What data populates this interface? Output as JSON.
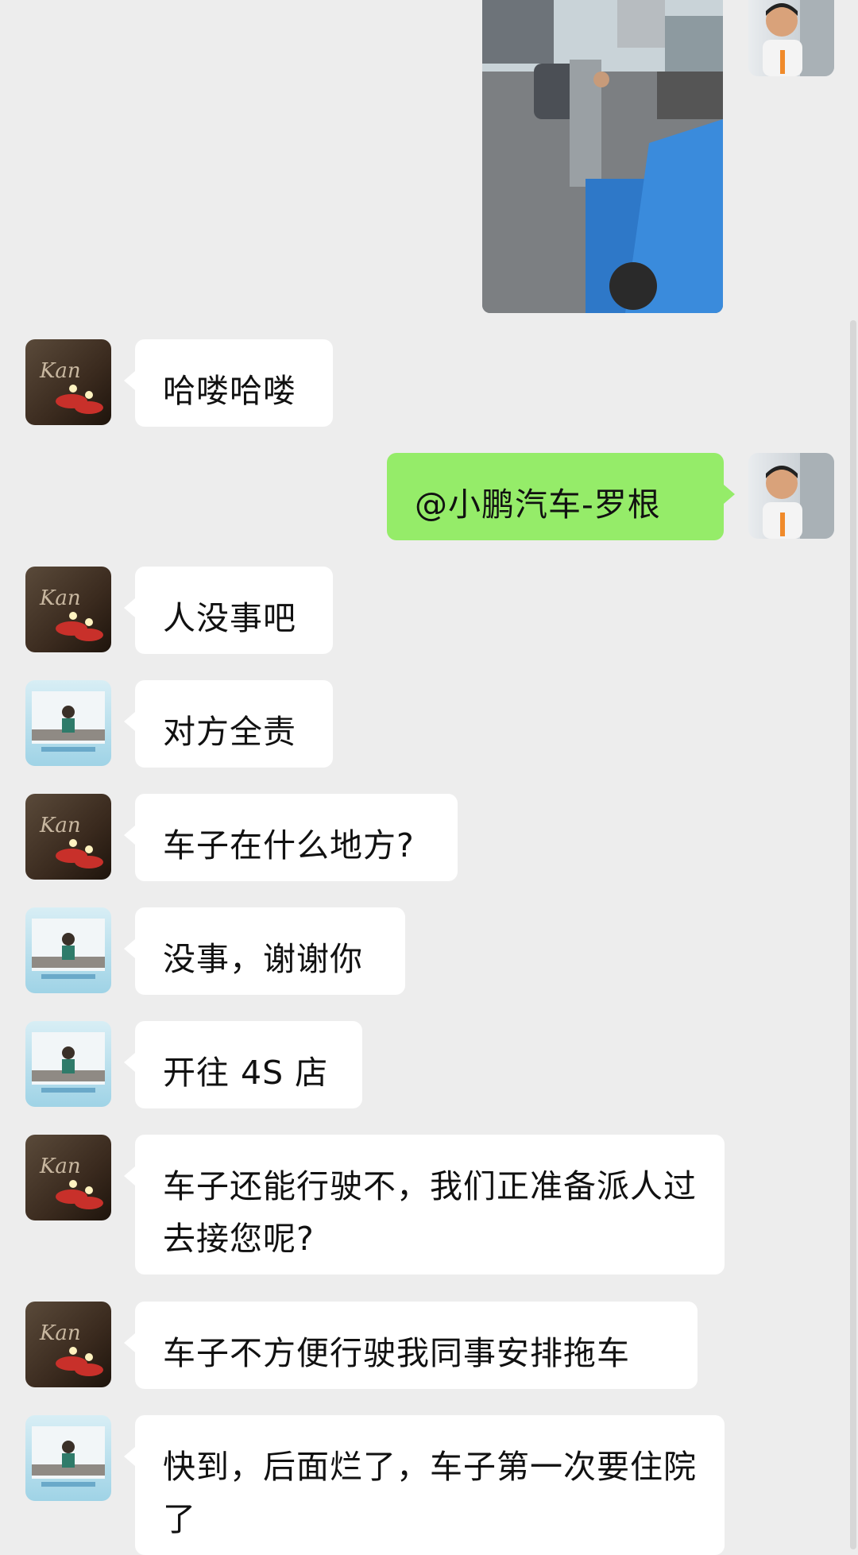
{
  "colors": {
    "background": "#ededed",
    "bubble_incoming": "#ffffff",
    "bubble_outgoing": "#95ec69"
  },
  "shared_photo": {
    "type": "image",
    "description_icon": "street-accident-photo"
  },
  "messages": [
    {
      "sender": "candle-avatar",
      "direction": "incoming",
      "text": "哈喽哈喽"
    },
    {
      "sender": "self-avatar",
      "direction": "outgoing",
      "text": "@小鹏汽车-罗根"
    },
    {
      "sender": "candle-avatar",
      "direction": "incoming",
      "text": "人没事吧"
    },
    {
      "sender": "office-avatar",
      "direction": "incoming",
      "text": "对方全责"
    },
    {
      "sender": "candle-avatar",
      "direction": "incoming",
      "text": "车子在什么地方?"
    },
    {
      "sender": "office-avatar",
      "direction": "incoming",
      "text": "没事，谢谢你"
    },
    {
      "sender": "office-avatar",
      "direction": "incoming",
      "text": "开往 4S 店"
    },
    {
      "sender": "candle-avatar",
      "direction": "incoming",
      "text": "车子还能行驶不，我们正准备派人过去接您呢?"
    },
    {
      "sender": "candle-avatar",
      "direction": "incoming",
      "text": "车子不方便行驶我同事安排拖车"
    },
    {
      "sender": "office-avatar",
      "direction": "incoming",
      "text": "快到，后面烂了，车子第一次要住院了"
    }
  ]
}
